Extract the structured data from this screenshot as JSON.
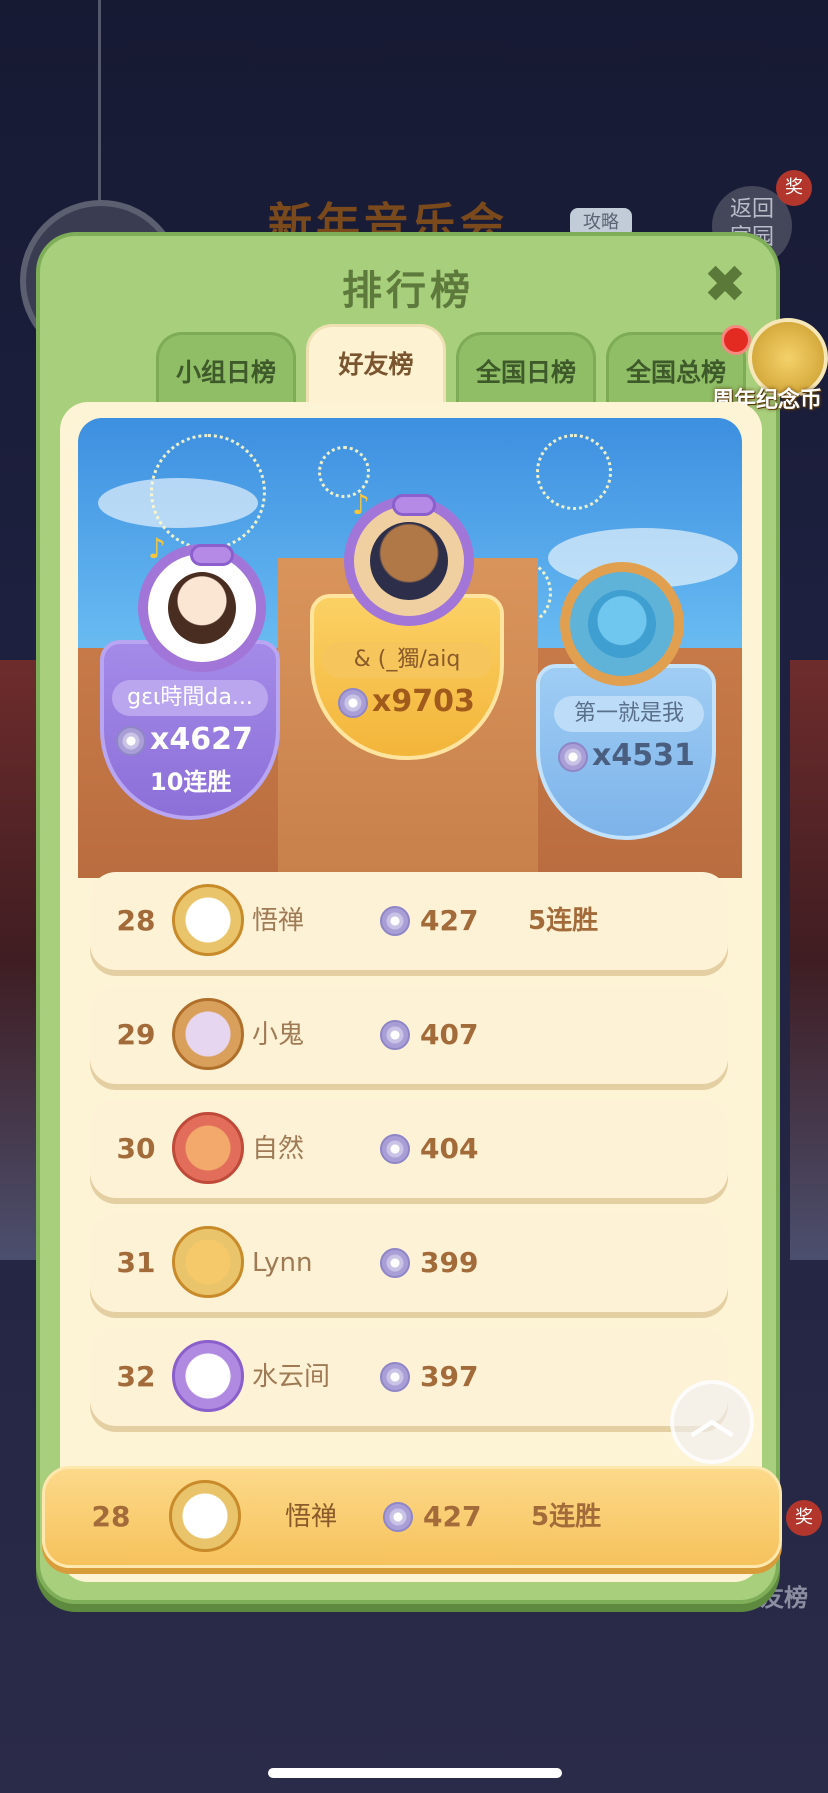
{
  "background": {
    "event_title": "新年音乐会",
    "guide_label": "攻略",
    "back_label": "返回\n家园",
    "prize_label": "奖",
    "bottom_label": "好友榜"
  },
  "panel": {
    "title": "排行榜",
    "close_icon": "✖"
  },
  "tabs": [
    {
      "label": "小组日榜",
      "active": false
    },
    {
      "label": "好友榜",
      "active": true
    },
    {
      "label": "全国日榜",
      "active": false
    },
    {
      "label": "全国总榜",
      "active": false,
      "has_badge": true
    }
  ],
  "coin_badge": {
    "label": "周年纪念币"
  },
  "podium": {
    "first": {
      "name": "& (_獨/aiq",
      "score": "x9703"
    },
    "second": {
      "name": "gɛι時間da...",
      "score": "x4627",
      "streak": "10连胜"
    },
    "third": {
      "name": "第一就是我",
      "score": "x4531"
    }
  },
  "ranking": [
    {
      "rank": "28",
      "name": "悟禅",
      "score": "427",
      "streak": "5连胜",
      "avatar_color": "#e9c46a"
    },
    {
      "rank": "29",
      "name": "小鬼",
      "score": "407",
      "streak": "",
      "avatar_color": "#d9a05b"
    },
    {
      "rank": "30",
      "name": "自然",
      "score": "404",
      "streak": "",
      "avatar_color": "#e26d5a"
    },
    {
      "rank": "31",
      "name": "Lynn",
      "score": "399",
      "streak": "",
      "avatar_color": "#e9c46a"
    },
    {
      "rank": "32",
      "name": "水云间",
      "score": "397",
      "streak": "",
      "avatar_color": "#b08ae0"
    }
  ],
  "my_rank": {
    "rank": "28",
    "name": "悟禅",
    "score": "427",
    "streak": "5连胜"
  },
  "scroll_top_icon": "︿"
}
